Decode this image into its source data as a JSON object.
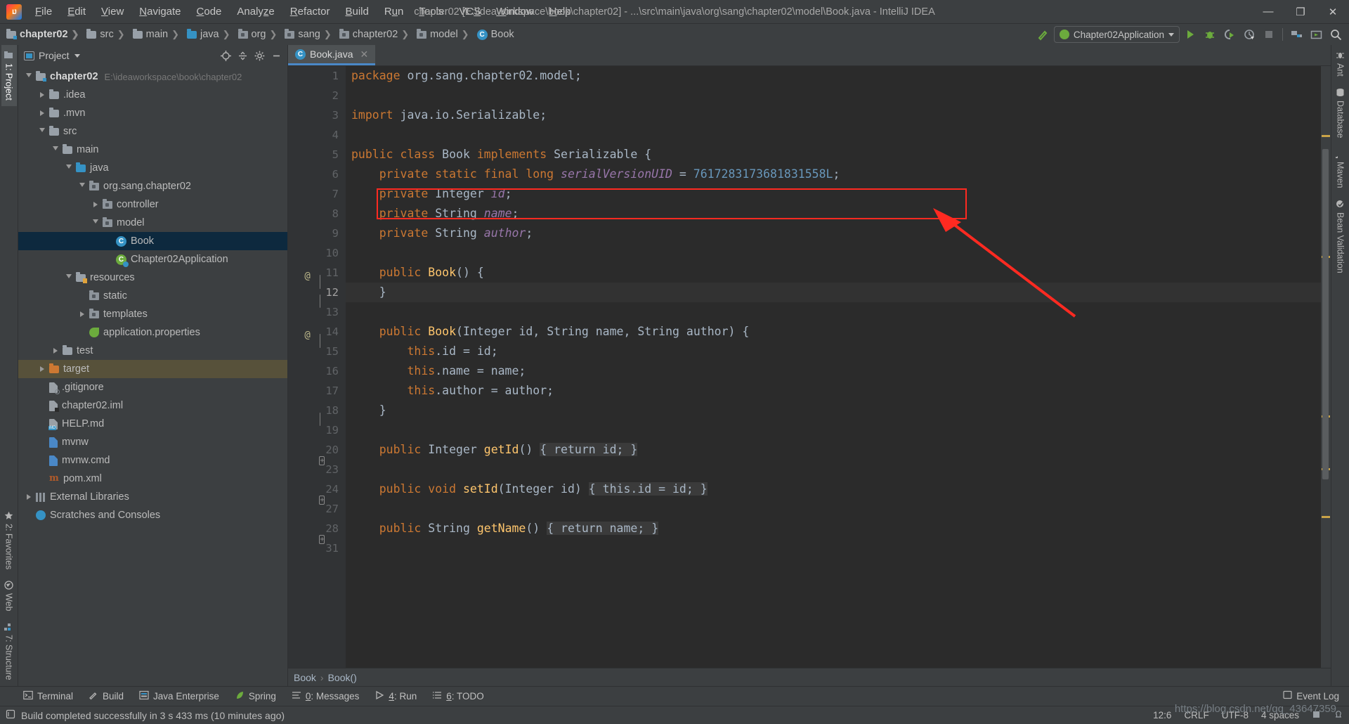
{
  "window": {
    "title": "chapter02 [E:\\ideaworkspace\\book\\chapter02] - ...\\src\\main\\java\\org\\sang\\chapter02\\model\\Book.java - IntelliJ IDEA",
    "logo": "intellij-idea-logo",
    "minimize": "—",
    "maximize": "❐",
    "close": "✕"
  },
  "menubar": [
    {
      "label": "File"
    },
    {
      "label": "Edit"
    },
    {
      "label": "View"
    },
    {
      "label": "Navigate"
    },
    {
      "label": "Code"
    },
    {
      "label": "Analyze"
    },
    {
      "label": "Refactor"
    },
    {
      "label": "Build"
    },
    {
      "label": "Run"
    },
    {
      "label": "Tools"
    },
    {
      "label": "VCS"
    },
    {
      "label": "Window"
    },
    {
      "label": "Help"
    }
  ],
  "breadcrumb_nav": [
    {
      "label": "chapter02",
      "icon": "module-folder-icon",
      "bold": true
    },
    {
      "label": "src",
      "icon": "folder-icon",
      "bold": false
    },
    {
      "label": "main",
      "icon": "folder-icon",
      "bold": false
    },
    {
      "label": "java",
      "icon": "source-root-folder-icon",
      "bold": false
    },
    {
      "label": "org",
      "icon": "package-icon",
      "bold": false
    },
    {
      "label": "sang",
      "icon": "package-icon",
      "bold": false
    },
    {
      "label": "chapter02",
      "icon": "package-icon",
      "bold": false
    },
    {
      "label": "model",
      "icon": "package-icon",
      "bold": false
    },
    {
      "label": "Book",
      "icon": "java-class-icon",
      "bold": false
    }
  ],
  "toolbar": {
    "build_hammer": "build-icon",
    "run_config": "Chapter02Application",
    "run": "run-icon",
    "debug": "debug-icon",
    "run_coverage": "run-with-coverage-icon",
    "profile": "profiler-icon",
    "stop": "stop-icon",
    "project_structure": "project-structure-icon",
    "updates": "updates-icon",
    "search": "search-everywhere-icon"
  },
  "left_toolwindows": [
    {
      "label": "1: Project",
      "icon": "project-icon",
      "active": true
    },
    {
      "label": "2: Favorites",
      "icon": "star-icon",
      "active": false
    },
    {
      "label": "Web",
      "icon": "web-icon",
      "active": false
    },
    {
      "label": "7: Structure",
      "icon": "structure-icon",
      "active": false
    }
  ],
  "right_toolwindows": [
    {
      "label": "Ant",
      "icon": "ant-icon"
    },
    {
      "label": "Database",
      "icon": "database-icon"
    },
    {
      "label": "Maven",
      "icon": "maven-icon"
    },
    {
      "label": "Bean Validation",
      "icon": "bean-validation-icon"
    }
  ],
  "project_panel": {
    "title": "Project",
    "dropdown": "chevron-down-icon",
    "actions": [
      "locate-icon",
      "collapse-all-icon",
      "settings-gear-icon",
      "hide-icon"
    ],
    "tree": [
      {
        "depth": 0,
        "arrow": "open",
        "icon": "module-folder-icon",
        "label": "chapter02",
        "bold": true,
        "path": "E:\\ideaworkspace\\book\\chapter02",
        "state": "normal"
      },
      {
        "depth": 1,
        "arrow": "closed",
        "icon": "folder-icon",
        "label": ".idea",
        "state": "normal"
      },
      {
        "depth": 1,
        "arrow": "closed",
        "icon": "folder-icon",
        "label": ".mvn",
        "state": "normal"
      },
      {
        "depth": 1,
        "arrow": "open",
        "icon": "folder-icon",
        "label": "src",
        "state": "normal"
      },
      {
        "depth": 2,
        "arrow": "open",
        "icon": "folder-icon",
        "label": "main",
        "state": "normal"
      },
      {
        "depth": 3,
        "arrow": "open",
        "icon": "source-root-folder-icon",
        "label": "java",
        "state": "normal"
      },
      {
        "depth": 4,
        "arrow": "open",
        "icon": "package-icon",
        "label": "org.sang.chapter02",
        "state": "normal"
      },
      {
        "depth": 5,
        "arrow": "closed",
        "icon": "package-icon",
        "label": "controller",
        "state": "normal"
      },
      {
        "depth": 5,
        "arrow": "open",
        "icon": "package-icon",
        "label": "model",
        "state": "normal"
      },
      {
        "depth": 6,
        "arrow": "none",
        "icon": "java-class-icon",
        "label": "Book",
        "state": "selected"
      },
      {
        "depth": 6,
        "arrow": "none",
        "icon": "spring-class-icon",
        "label": "Chapter02Application",
        "state": "normal"
      },
      {
        "depth": 3,
        "arrow": "open",
        "icon": "resource-folder-icon",
        "label": "resources",
        "state": "normal"
      },
      {
        "depth": 4,
        "arrow": "none",
        "icon": "package-icon",
        "label": "static",
        "state": "normal"
      },
      {
        "depth": 4,
        "arrow": "closed",
        "icon": "package-icon",
        "label": "templates",
        "state": "normal"
      },
      {
        "depth": 4,
        "arrow": "none",
        "icon": "spring-properties-icon",
        "label": "application.properties",
        "state": "normal"
      },
      {
        "depth": 2,
        "arrow": "closed",
        "icon": "folder-icon",
        "label": "test",
        "state": "normal"
      },
      {
        "depth": 1,
        "arrow": "closed",
        "icon": "excluded-folder-icon",
        "label": "target",
        "state": "highlight"
      },
      {
        "depth": 1,
        "arrow": "none",
        "icon": "gitignore-file-icon",
        "label": ".gitignore",
        "state": "normal"
      },
      {
        "depth": 1,
        "arrow": "none",
        "icon": "iml-file-icon",
        "label": "chapter02.iml",
        "state": "normal"
      },
      {
        "depth": 1,
        "arrow": "none",
        "icon": "markdown-file-icon",
        "label": "HELP.md",
        "state": "normal"
      },
      {
        "depth": 1,
        "arrow": "none",
        "icon": "shell-file-icon",
        "label": "mvnw",
        "state": "normal"
      },
      {
        "depth": 1,
        "arrow": "none",
        "icon": "cmd-file-icon",
        "label": "mvnw.cmd",
        "state": "normal"
      },
      {
        "depth": 1,
        "arrow": "none",
        "icon": "maven-pom-icon",
        "label": "pom.xml",
        "state": "normal"
      },
      {
        "depth": 0,
        "arrow": "closed",
        "icon": "libraries-icon",
        "label": "External Libraries",
        "state": "normal"
      },
      {
        "depth": 0,
        "arrow": "none",
        "icon": "scratches-icon",
        "label": "Scratches and Consoles",
        "state": "normal"
      }
    ]
  },
  "editor": {
    "tab": {
      "label": "Book.java",
      "icon": "java-class-icon",
      "close": "✕"
    },
    "caret_line": 12,
    "lines": [
      {
        "num": "1",
        "gutter": "",
        "tokens": [
          {
            "t": "package ",
            "c": "kw"
          },
          {
            "t": "org.sang.chapter02.model;",
            "c": "op"
          }
        ]
      },
      {
        "num": "2",
        "gutter": "",
        "tokens": []
      },
      {
        "num": "3",
        "gutter": "",
        "tokens": [
          {
            "t": "import ",
            "c": "kw"
          },
          {
            "t": "java.io.Serializable;",
            "c": "op"
          }
        ]
      },
      {
        "num": "4",
        "gutter": "",
        "tokens": []
      },
      {
        "num": "5",
        "gutter": "",
        "tokens": [
          {
            "t": "public class ",
            "c": "kw"
          },
          {
            "t": "Book ",
            "c": "cls"
          },
          {
            "t": "implements ",
            "c": "kw"
          },
          {
            "t": "Serializable {",
            "c": "cls"
          }
        ]
      },
      {
        "num": "6",
        "gutter": "",
        "tokens": [
          {
            "t": "    private static final long ",
            "c": "kw"
          },
          {
            "t": "serialVersionUID",
            "c": "fld"
          },
          {
            "t": " = ",
            "c": "op"
          },
          {
            "t": "7617283173681831558L",
            "c": "num"
          },
          {
            "t": ";",
            "c": "op"
          }
        ]
      },
      {
        "num": "7",
        "gutter": "",
        "tokens": [
          {
            "t": "    private ",
            "c": "kw"
          },
          {
            "t": "Integer ",
            "c": "cls"
          },
          {
            "t": "id",
            "c": "fld"
          },
          {
            "t": ";",
            "c": "op"
          }
        ]
      },
      {
        "num": "8",
        "gutter": "",
        "tokens": [
          {
            "t": "    private ",
            "c": "kw"
          },
          {
            "t": "String ",
            "c": "cls"
          },
          {
            "t": "name",
            "c": "fld"
          },
          {
            "t": ";",
            "c": "op"
          }
        ]
      },
      {
        "num": "9",
        "gutter": "",
        "tokens": [
          {
            "t": "    private ",
            "c": "kw"
          },
          {
            "t": "String ",
            "c": "cls"
          },
          {
            "t": "author",
            "c": "fld"
          },
          {
            "t": ";",
            "c": "op"
          }
        ]
      },
      {
        "num": "10",
        "gutter": "",
        "tokens": []
      },
      {
        "num": "11",
        "gutter": "@",
        "fold": "brace-up",
        "tokens": [
          {
            "t": "    public ",
            "c": "kw"
          },
          {
            "t": "Book",
            "c": "mth"
          },
          {
            "t": "() {",
            "c": "op"
          }
        ]
      },
      {
        "num": "12",
        "gutter": "",
        "fold": "brace-down",
        "tokens": [
          {
            "t": "    }",
            "c": "op"
          }
        ]
      },
      {
        "num": "13",
        "gutter": "",
        "tokens": []
      },
      {
        "num": "14",
        "gutter": "@",
        "fold": "brace-up",
        "tokens": [
          {
            "t": "    public ",
            "c": "kw"
          },
          {
            "t": "Book",
            "c": "mth"
          },
          {
            "t": "(",
            "c": "op"
          },
          {
            "t": "Integer ",
            "c": "cls"
          },
          {
            "t": "id",
            "c": "op"
          },
          {
            "t": ", ",
            "c": "op"
          },
          {
            "t": "String ",
            "c": "cls"
          },
          {
            "t": "name",
            "c": "op"
          },
          {
            "t": ", ",
            "c": "op"
          },
          {
            "t": "String ",
            "c": "cls"
          },
          {
            "t": "author",
            "c": "op"
          },
          {
            "t": ") {",
            "c": "op"
          }
        ]
      },
      {
        "num": "15",
        "gutter": "",
        "tokens": [
          {
            "t": "        this",
            "c": "kw"
          },
          {
            "t": ".id = id;",
            "c": "op"
          }
        ]
      },
      {
        "num": "16",
        "gutter": "",
        "tokens": [
          {
            "t": "        this",
            "c": "kw"
          },
          {
            "t": ".name = name;",
            "c": "op"
          }
        ]
      },
      {
        "num": "17",
        "gutter": "",
        "tokens": [
          {
            "t": "        this",
            "c": "kw"
          },
          {
            "t": ".author = author;",
            "c": "op"
          }
        ]
      },
      {
        "num": "18",
        "gutter": "",
        "fold": "brace-down",
        "tokens": [
          {
            "t": "    }",
            "c": "op"
          }
        ]
      },
      {
        "num": "19",
        "gutter": "",
        "tokens": []
      },
      {
        "num": "20",
        "gutter": "",
        "fold": "plus",
        "tokens": [
          {
            "t": "    public ",
            "c": "kw"
          },
          {
            "t": "Integer ",
            "c": "cls"
          },
          {
            "t": "getId",
            "c": "mth"
          },
          {
            "t": "() ",
            "c": "op"
          },
          {
            "t": "{ return id; }",
            "c": "folded"
          }
        ]
      },
      {
        "num": "23",
        "gutter": "",
        "tokens": []
      },
      {
        "num": "24",
        "gutter": "",
        "fold": "plus",
        "tokens": [
          {
            "t": "    public ",
            "c": "kw"
          },
          {
            "t": "void ",
            "c": "kw"
          },
          {
            "t": "setId",
            "c": "mth"
          },
          {
            "t": "(",
            "c": "op"
          },
          {
            "t": "Integer ",
            "c": "cls"
          },
          {
            "t": "id",
            "c": "op"
          },
          {
            "t": ") ",
            "c": "op"
          },
          {
            "t": "{ this.id = id; }",
            "c": "folded"
          }
        ]
      },
      {
        "num": "27",
        "gutter": "",
        "tokens": []
      },
      {
        "num": "28",
        "gutter": "",
        "fold": "plus",
        "tokens": [
          {
            "t": "    public ",
            "c": "kw"
          },
          {
            "t": "String ",
            "c": "cls"
          },
          {
            "t": "getName",
            "c": "mth"
          },
          {
            "t": "() ",
            "c": "op"
          },
          {
            "t": "{ return name; }",
            "c": "folded"
          }
        ]
      },
      {
        "num": "31",
        "gutter": "",
        "tokens": []
      }
    ],
    "breadcrumbs": [
      {
        "label": "Book"
      },
      {
        "label": "Book()"
      }
    ]
  },
  "bottom_toolwindows": [
    {
      "label": "Terminal",
      "icon": "terminal-icon"
    },
    {
      "label": "Build",
      "icon": "build-hammer-icon"
    },
    {
      "label": "Java Enterprise",
      "icon": "java-enterprise-icon"
    },
    {
      "label": "Spring",
      "icon": "spring-leaf-icon"
    },
    {
      "label": "0: Messages",
      "icon": "messages-icon"
    },
    {
      "label": "4: Run",
      "icon": "run-icon"
    },
    {
      "label": "6: TODO",
      "icon": "todo-icon"
    }
  ],
  "statusbar": {
    "message": "Build completed successfully in 3 s 433 ms (10 minutes ago)",
    "message_icon": "notification-icon",
    "caret_position": "12:6",
    "line_separator": "CRLF",
    "encoding": "UTF-8",
    "indent": "4 spaces",
    "lock_icon": "write-access-icon",
    "inspector_icon": "inspections-icon",
    "event_log": "Event Log",
    "event_log_icon": "event-log-icon",
    "watermark": "https://blog.csdn.net/qq_43647359"
  },
  "annotation": {
    "highlight_color": "#ff2a21",
    "target_line": 6,
    "shape": "rectangle-with-arrow"
  }
}
